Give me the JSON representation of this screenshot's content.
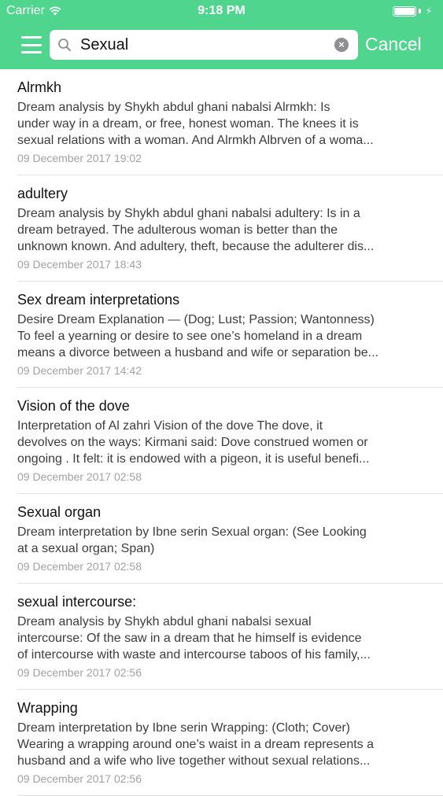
{
  "status_bar": {
    "carrier": "Carrier",
    "time": "9:18 PM",
    "battery_level": 1.0
  },
  "search": {
    "query": "Sexual",
    "cancel_label": "Cancel"
  },
  "colors": {
    "header": "#4fd58d",
    "date": "#a2a2a2"
  },
  "results": [
    {
      "title": "Alrmkh",
      "lines": [
        "Dream analysis by Shykh abdul ghani nabalsi     Alrmkh:  Is",
        "under way in a dream, or free, honest woman. The knees it is",
        "sexual relations with a woman. And Alrmkh Albrven of a woma..."
      ],
      "date": "09 December 2017 19:02"
    },
    {
      "title": "adultery",
      "lines": [
        "Dream analysis by Shykh abdul ghani nabalsi     adultery:  Is in a",
        "dream betrayed. The adulterous woman is better than the",
        "unknown known. And adultery, theft, because the adulterer dis..."
      ],
      "date": "09 December 2017 18:43"
    },
    {
      "title": "Sex dream interpretations",
      "lines": [
        "Desire Dream Explanation — (Dog; Lust; Passion; Wantonness)",
        "To feel a yearning or desire to see one’s homeland in a dream",
        "means a divorce between a husband and wife or separation be..."
      ],
      "date": "09 December 2017 14:42"
    },
    {
      "title": "Vision of the dove",
      "lines": [
        "Interpretation of Al zahri     Vision of the dove  The dove, it",
        "devolves on the ways:  Kirmani said: Dove construed women or",
        "ongoing .  It felt: it is endowed with a pigeon, it is useful benefi..."
      ],
      "date": "09 December 2017 02:58"
    },
    {
      "title": "Sexual organ",
      "lines": [
        "Dream interpretation by Ibne serin     Sexual organ: (See Looking",
        "at a sexual organ; Span)"
      ],
      "date": "09 December 2017 02:58"
    },
    {
      "title": "sexual intercourse:",
      "lines": [
        "Dream analysis by Shykh abdul ghani nabalsi     sexual",
        "intercourse:  Of the saw in a dream that he himself is evidence",
        "of intercourse with waste and intercourse taboos of his family,..."
      ],
      "date": "09 December 2017 02:56"
    },
    {
      "title": "Wrapping",
      "lines": [
        "Dream interpretation by Ibne serin     Wrapping: (Cloth; Cover)",
        "Wearing a wrapping around one’s waist in a dream represents a",
        "husband and a wife who live together without sexual relations..."
      ],
      "date": "09 December 2017 02:56"
    }
  ]
}
